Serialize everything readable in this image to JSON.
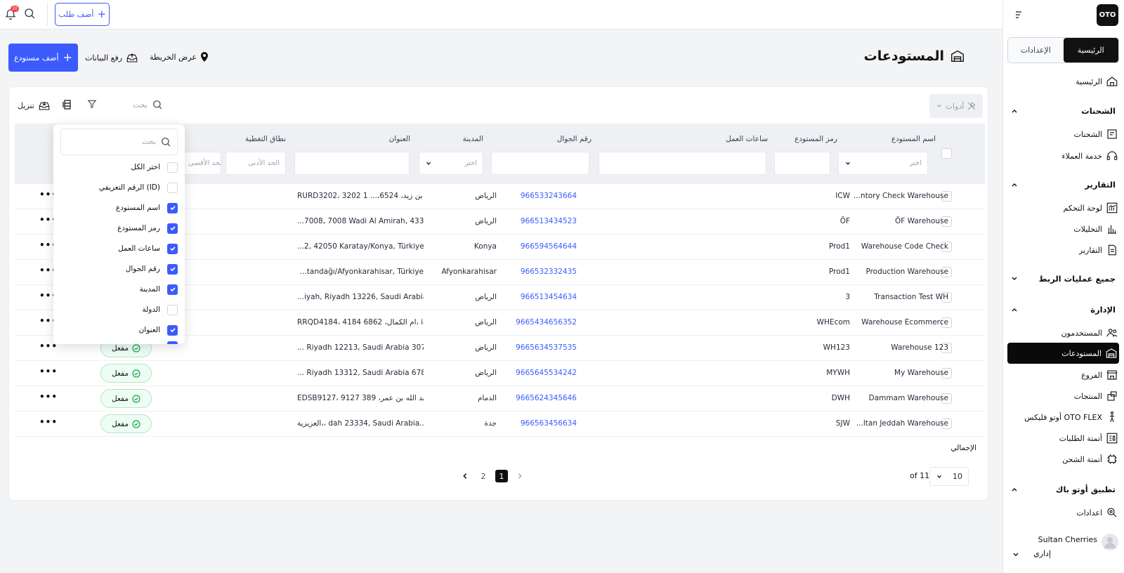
{
  "brand": {
    "logo": "OTO"
  },
  "topbar": {
    "add_order": "أضف طلب",
    "notif_count": "10"
  },
  "sidebar": {
    "tabs": [
      {
        "label": "الرئيسية",
        "active": true
      },
      {
        "label": "الإعدادات",
        "active": false
      }
    ],
    "home": "الرئيسية",
    "sections": {
      "shipments": "الشحنات",
      "reports": "التقارير",
      "integrations": "جميع عمليات الربط",
      "management": "الإدارة",
      "otopack": "تطبيق أوتو باك"
    },
    "items": {
      "shipments": "الشحنات",
      "customer_service": "خدمة العملاء",
      "dashboard": "لوحة التحكم",
      "analytics": "التحليلات",
      "reports": "التقارير",
      "users": "المستخدمون",
      "warehouses": "المستودعات",
      "branches": "الفروع",
      "products": "المنتجات",
      "oto_flex": "أوتو فليكس OTO FLEX",
      "order_automation": "أتمتة الطلبات",
      "shipping_automation": "أتمتة الشحن",
      "otopack_settings": "اعدادات"
    },
    "user": {
      "name": "Sultan Cherries",
      "role": "إداري"
    }
  },
  "page": {
    "title": "المستودعات",
    "add_warehouse": "أضف مستودع",
    "upload_data": "رفع البيانات",
    "map_view": "عرض الخريطة"
  },
  "toolbar": {
    "tools": "أدوات",
    "search_placeholder": "بحث",
    "download": "تنزيل"
  },
  "table": {
    "headers": {
      "name": "اسم المستودع",
      "code": "رمز المستودع",
      "hours": "ساعات العمل",
      "phone": "رقم الجوال",
      "city": "المدينة",
      "address": "العنوان",
      "coverage": "نطاق التغطية"
    },
    "filters": {
      "select": "اختر",
      "min": "الحد الأدنى",
      "max": "الحد الأقصى"
    },
    "rows": [
      {
        "name": "...ntory Check Warehouse",
        "code": "ICW",
        "phone": "966533243664",
        "city": "الرياض",
        "address": "RURD3202، 3202 خالد بن زيد، 6524،... 1",
        "status": ""
      },
      {
        "name": "ÖF Warehouse",
        "code": "ÖF",
        "phone": "966513434523",
        "city": "الرياض",
        "address": "...7008, 7008 Wadi Al Amirah, 4334",
        "status": ""
      },
      {
        "name": "Warehouse Code Check",
        "code": "Prod1",
        "phone": "966594564644",
        "city": "Konya",
        "address": "...2, 42050 Karatay/Konya, Türkiye",
        "status": ""
      },
      {
        "name": "Production Warehouse",
        "code": "Prod1",
        "phone": "966532332435",
        "city": "Afyonkarahisar",
        "address": "...tandağı/Afyonkarahisar, Türkiye",
        "status": ""
      },
      {
        "name": "Transaction Test WH",
        "code": "3",
        "phone": "966513454634",
        "city": "الرياض",
        "address": "...iyah, Riyadh 13226, Saudi Arabia",
        "status": ""
      },
      {
        "name": "Warehouse Ecommerce",
        "code": "WHEcom",
        "phone": "9665434656352",
        "city": "الرياض",
        "address": "RRQD4184، 4184 ام الكمال، 6862، ia...",
        "status": ""
      },
      {
        "name": "Warehouse 123",
        "code": "WH123",
        "phone": "9665634537535",
        "city": "الرياض",
        "address": "... Riyadh 12213, Saudi Arabia 3074",
        "status": "مفعل"
      },
      {
        "name": "My Warehouse",
        "code": "MYWH",
        "phone": "9665645534242",
        "city": "الرياض",
        "address": "... Riyadh 13312, Saudi Arabia 6780",
        "status": "مفعل"
      },
      {
        "name": "Dammam Warehouse",
        "code": "DWH",
        "phone": "9665624345646",
        "city": "الدمام",
        "address": "EDSB9127، 9127 عبد الله بن عمر، 389...",
        "status": "مفعل"
      },
      {
        "name": "...ltan Jeddah Warehouse",
        "code": "SJW",
        "phone": "966563456634",
        "city": "جدة",
        "address": "العزيزية،، dah 23334, Saudi Arabia...",
        "status": "مفعل"
      }
    ],
    "total_label": "الإجمالي"
  },
  "pagination": {
    "pages": [
      "1",
      "2"
    ],
    "current": "1",
    "per_page": "10",
    "of_label": "of 11"
  },
  "column_picker": {
    "search_placeholder": "بحث",
    "options": [
      {
        "label": "اختر الكل",
        "checked": false
      },
      {
        "label": "الرقم التعريفي (ID)",
        "checked": false
      },
      {
        "label": "اسم المستودع",
        "checked": true
      },
      {
        "label": "رمز المستودع",
        "checked": true
      },
      {
        "label": "ساعات العمل",
        "checked": true
      },
      {
        "label": "رقم الجوال",
        "checked": true
      },
      {
        "label": "المدينة",
        "checked": true
      },
      {
        "label": "الدولة",
        "checked": false
      },
      {
        "label": "العنوان",
        "checked": true
      }
    ]
  },
  "colors": {
    "accent": "#3b5bfd",
    "dark": "#0a0a0a",
    "success_bg": "#ecfdf3",
    "success": "#16a34a",
    "badge": "#ef4444"
  }
}
